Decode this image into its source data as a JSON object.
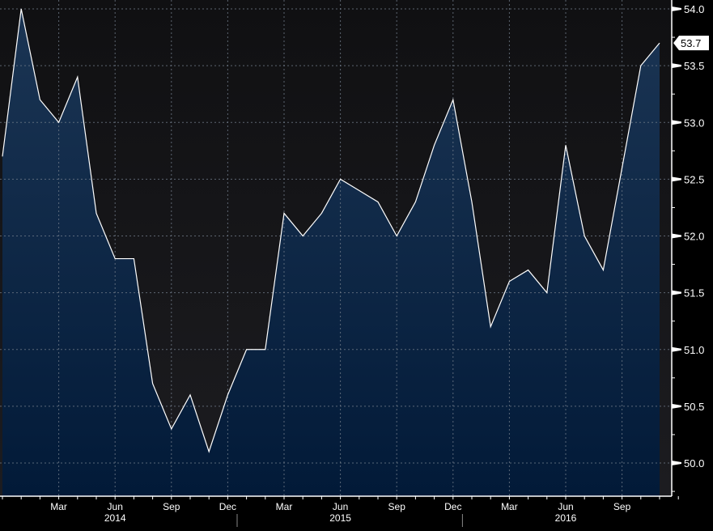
{
  "chart_data": {
    "type": "area",
    "title": "",
    "xlabel": "",
    "ylabel": "",
    "ylim": [
      49.75,
      54.05
    ],
    "grid": true,
    "x": [
      "Dec 2013",
      "Jan 2014",
      "Feb 2014",
      "Mar 2014",
      "Apr 2014",
      "May 2014",
      "Jun 2014",
      "Jul 2014",
      "Aug 2014",
      "Sep 2014",
      "Oct 2014",
      "Nov 2014",
      "Dec 2014",
      "Jan 2015",
      "Feb 2015",
      "Mar 2015",
      "Apr 2015",
      "May 2015",
      "Jun 2015",
      "Jul 2015",
      "Aug 2015",
      "Sep 2015",
      "Oct 2015",
      "Nov 2015",
      "Dec 2015",
      "Jan 2016",
      "Feb 2016",
      "Mar 2016",
      "Apr 2016",
      "May 2016",
      "Jun 2016",
      "Jul 2016",
      "Aug 2016",
      "Sep 2016",
      "Oct 2016",
      "Nov 2016"
    ],
    "values": [
      52.7,
      54.0,
      53.2,
      53.0,
      53.4,
      52.2,
      51.8,
      51.8,
      50.7,
      50.3,
      50.6,
      50.1,
      50.6,
      51.0,
      51.0,
      52.2,
      52.0,
      52.2,
      52.5,
      52.4,
      52.3,
      52.0,
      52.3,
      52.8,
      53.2,
      52.3,
      51.2,
      51.6,
      51.7,
      51.5,
      52.8,
      52.0,
      51.7,
      52.6,
      53.5,
      53.7
    ],
    "y_ticks": [
      "50.0",
      "50.5",
      "51.0",
      "51.5",
      "52.0",
      "52.5",
      "53.0",
      "53.5",
      "54.0"
    ],
    "x_ticks": [
      {
        "label": "Mar",
        "index": 3
      },
      {
        "label": "Jun",
        "index": 6
      },
      {
        "label": "Sep",
        "index": 9
      },
      {
        "label": "Dec",
        "index": 12
      },
      {
        "label": "Mar",
        "index": 15
      },
      {
        "label": "Jun",
        "index": 18
      },
      {
        "label": "Sep",
        "index": 21
      },
      {
        "label": "Dec",
        "index": 24
      },
      {
        "label": "Mar",
        "index": 27
      },
      {
        "label": "Jun",
        "index": 30
      },
      {
        "label": "Sep",
        "index": 33
      }
    ],
    "year_labels": [
      {
        "label": "2014",
        "index": 6
      },
      {
        "label": "2015",
        "index": 18
      },
      {
        "label": "2016",
        "index": 30
      }
    ],
    "last_value_label": "53.7",
    "colors": {
      "line": "#ffffff",
      "fill_top": "#1b3554",
      "fill_bottom": "#021a38",
      "bg_top": "#101012",
      "bg_bottom": "#1c1c20",
      "grid": "#6f7a88"
    }
  }
}
